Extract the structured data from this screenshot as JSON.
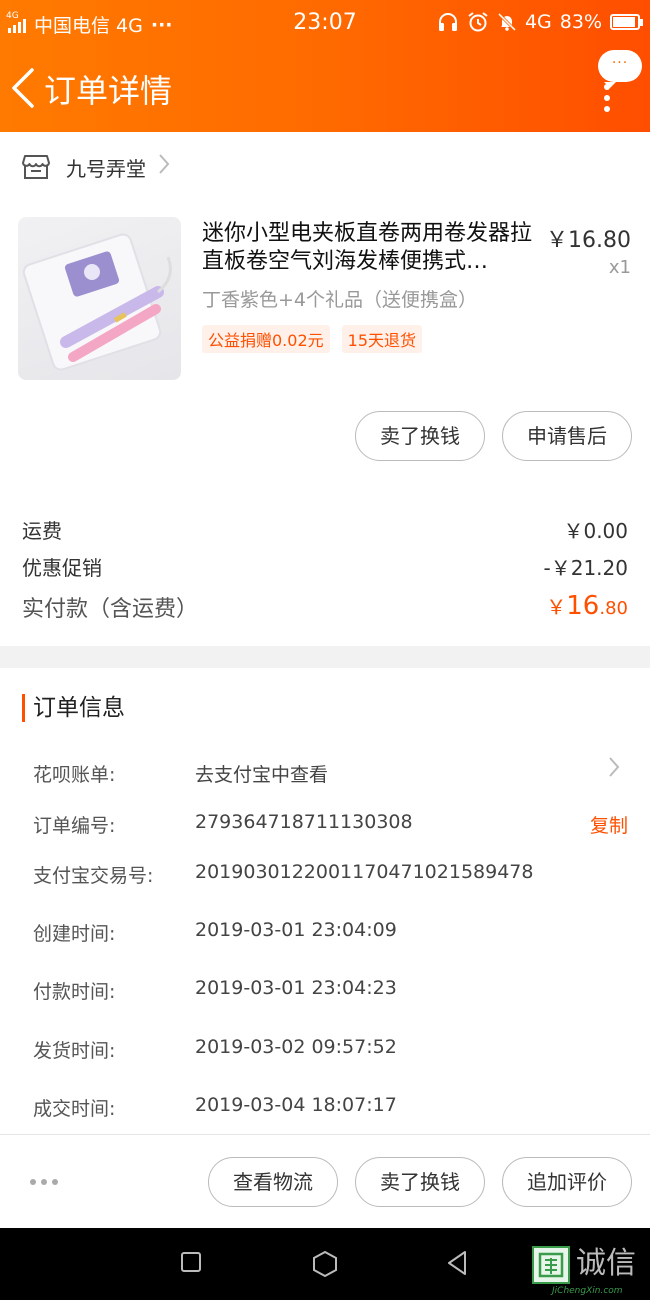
{
  "status_bar": {
    "network_small": "4G",
    "carrier": "中国电信 4G",
    "more": "···",
    "time": "23:07",
    "network": "4G",
    "battery": "83%",
    "battery_level": 0.83
  },
  "header": {
    "title": "订单详情",
    "message_bubble": "···"
  },
  "shop": {
    "name": "九号弄堂",
    "icon": "store-icon"
  },
  "product": {
    "title": "迷你小型电夹板直卷两用卷发器拉直板卷空气刘海发棒便携式…",
    "price": "￥16.80",
    "quantity": "x1",
    "sku": "丁香紫色+4个礼品（送便携盒）",
    "tags": [
      "公益捐赠0.02元",
      "15天退货"
    ]
  },
  "product_actions": {
    "sell": "卖了换钱",
    "after_sale": "申请售后"
  },
  "fees": {
    "shipping_label": "运费",
    "shipping_value": "￥0.00",
    "discount_label": "优惠促销",
    "discount_value": "-￥21.20",
    "total_label": "实付款（含运费）",
    "total_currency": "￥",
    "total_int": "16",
    "total_dec": ".80"
  },
  "order_info": {
    "title": "订单信息",
    "huabei_label": "花呗账单:",
    "huabei_value": "去支付宝中查看",
    "order_no_label": "订单编号:",
    "order_no_value": "279364718711130308",
    "copy_label": "复制",
    "alipay_label": "支付宝交易号:",
    "alipay_value": "2019030122001170471021589478",
    "created_label": "创建时间:",
    "created_value": "2019-03-01 23:04:09",
    "paid_label": "付款时间:",
    "paid_value": "2019-03-01 23:04:23",
    "shipped_label": "发货时间:",
    "shipped_value": "2019-03-02 09:57:52",
    "closed_label": "成交时间:",
    "closed_value": "2019-03-04 18:07:17"
  },
  "bottom_actions": {
    "logistics": "查看物流",
    "sell": "卖了换钱",
    "review": "追加评价"
  },
  "watermark": {
    "text": "诚信",
    "sub": "JiChengXin.com"
  },
  "colors": {
    "accent": "#ff5000",
    "header_start": "#ff7a00",
    "header_end": "#ff4e00"
  }
}
